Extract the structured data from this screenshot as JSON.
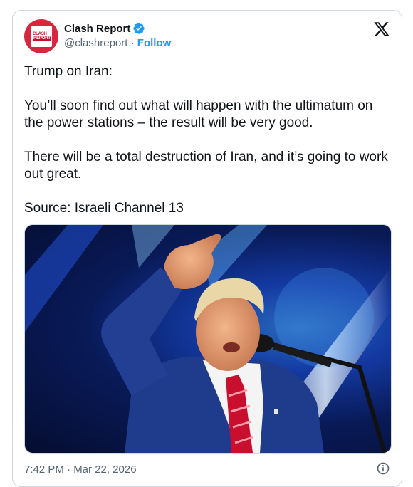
{
  "author": {
    "name": "Clash Report",
    "handle": "@clashreport",
    "separator": " · ",
    "follow_label": "Follow",
    "avatar_text_line1": "CLASH",
    "avatar_text_line2": "REPORT"
  },
  "tweet": {
    "paragraphs": [
      "Trump on Iran:",
      "You’ll soon find out what will happen with the ultimatum on the power stations – the result will be very good.",
      "There will be a total destruction of Iran, and it’s going to work out great.",
      "Source: Israeli Channel 13"
    ],
    "timestamp": "7:42 PM · Mar 22, 2026"
  },
  "colors": {
    "accent": "#1d9bf0",
    "avatar_bg": "#d7263d",
    "tie": "#c8102e",
    "suit": "#1f3c8c"
  }
}
